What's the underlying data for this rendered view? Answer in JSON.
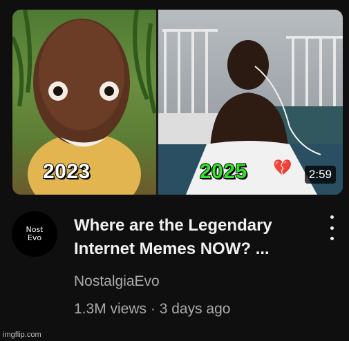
{
  "thumbnail": {
    "left_year": "2023",
    "right_year": "2025",
    "emoji": "💔",
    "duration": "2:59",
    "emoji_icon": "broken-heart-icon"
  },
  "channel_avatar": {
    "line1": "Nost",
    "line2": "Evo"
  },
  "video": {
    "title_line1": "Where are the Legendary",
    "title_line2": "Internet Memes NOW? ...",
    "channel": "NostalgiaEvo",
    "views": "1.3M views",
    "separator": "·",
    "age": "3 days ago"
  },
  "menu": {
    "icon": "kebab-menu-icon"
  },
  "watermark": "imgflip.com",
  "colors": {
    "background": "#0f0f0f",
    "title": "#f1f1f1",
    "meta": "#aaaaaa",
    "year_right": "#33e02b"
  }
}
